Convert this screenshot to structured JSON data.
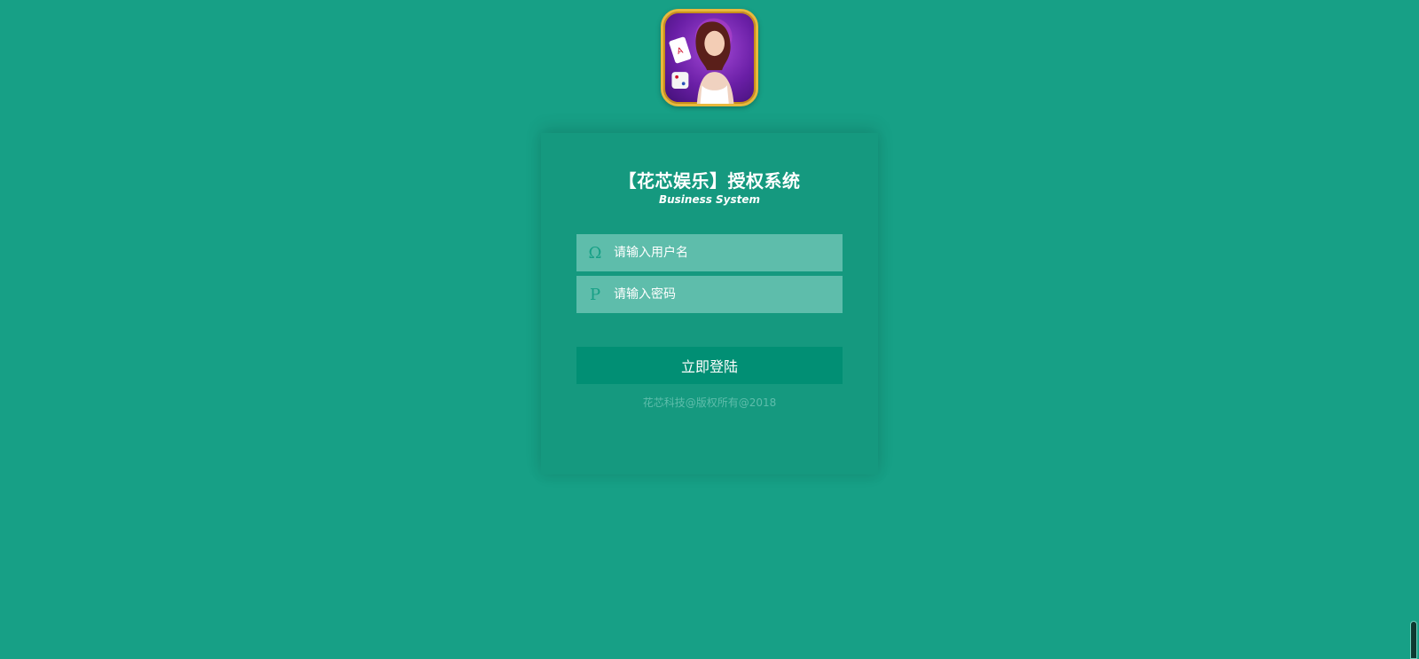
{
  "logo": {
    "icon": "app-logo-casino-girl-icon",
    "border_color": "#e8b93c"
  },
  "login": {
    "title": "【花芯娱乐】授权系统",
    "subtitle": "Business System",
    "username": {
      "icon": "user-icon",
      "glyph": "Ω",
      "placeholder": "请输入用户名",
      "value": ""
    },
    "password": {
      "icon": "password-icon",
      "glyph": "P",
      "placeholder": "请输入密码",
      "value": ""
    },
    "submit_label": "立即登陆",
    "copyright": "花芯科技@版权所有@2018"
  },
  "colors": {
    "background": "#17a086",
    "panel": "#15997f",
    "input": "#5ebdab",
    "button": "#018f74"
  }
}
